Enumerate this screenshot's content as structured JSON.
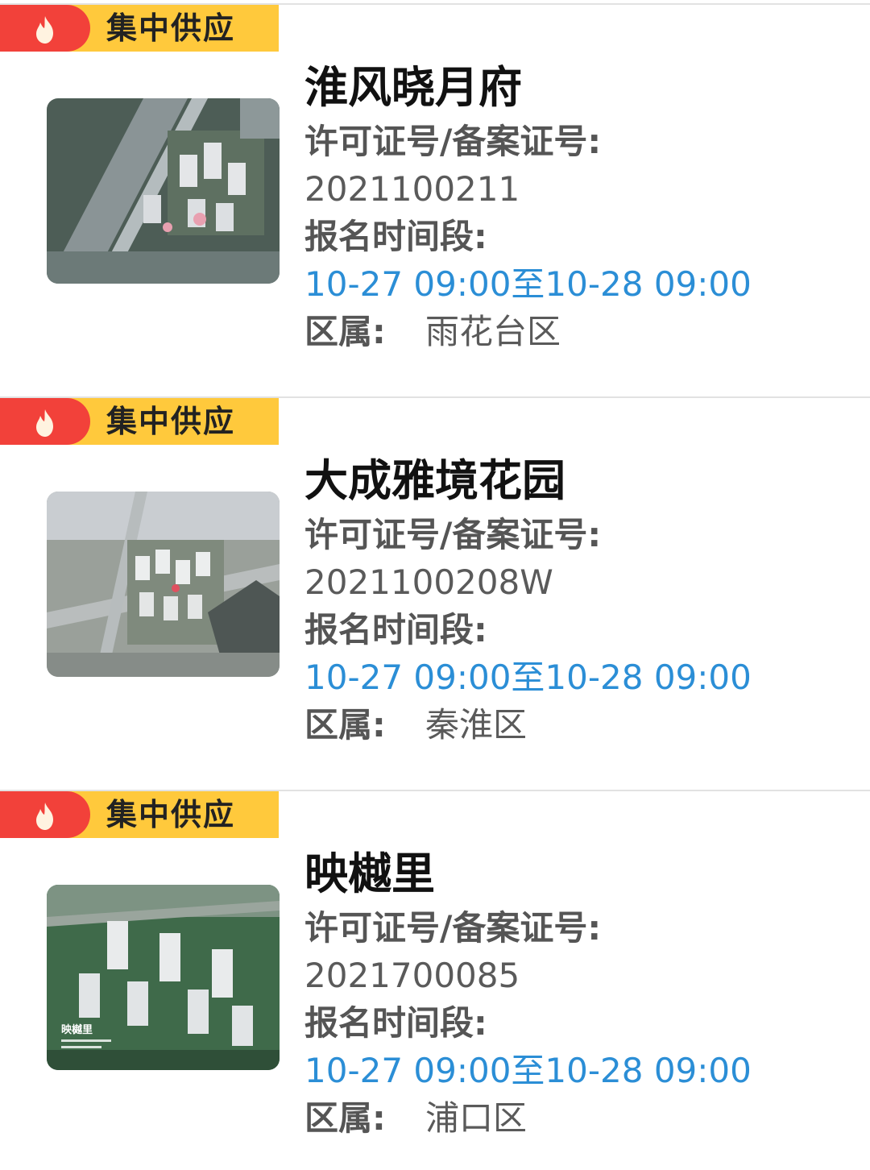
{
  "badge_label": "集中供应",
  "license_label": "许可证号/备案证号:",
  "time_label": "报名时间段:",
  "district_label": "区属:",
  "listings": [
    {
      "name": "淮风晓月府",
      "license": "2021100211",
      "time_range": "10-27 09:00至10-28 09:00",
      "district": "雨花台区"
    },
    {
      "name": "大成雅境花园",
      "license": "2021100208W",
      "time_range": "10-27 09:00至10-28 09:00",
      "district": "秦淮区"
    },
    {
      "name": "映樾里",
      "license": "2021700085",
      "time_range": "10-27 09:00至10-28 09:00",
      "district": "浦口区"
    }
  ],
  "thumb3_caption": "映樾里",
  "colors": {
    "badge_yellow": "#ffc93c",
    "badge_red": "#f2413a",
    "time_blue": "#2b8ed6"
  }
}
